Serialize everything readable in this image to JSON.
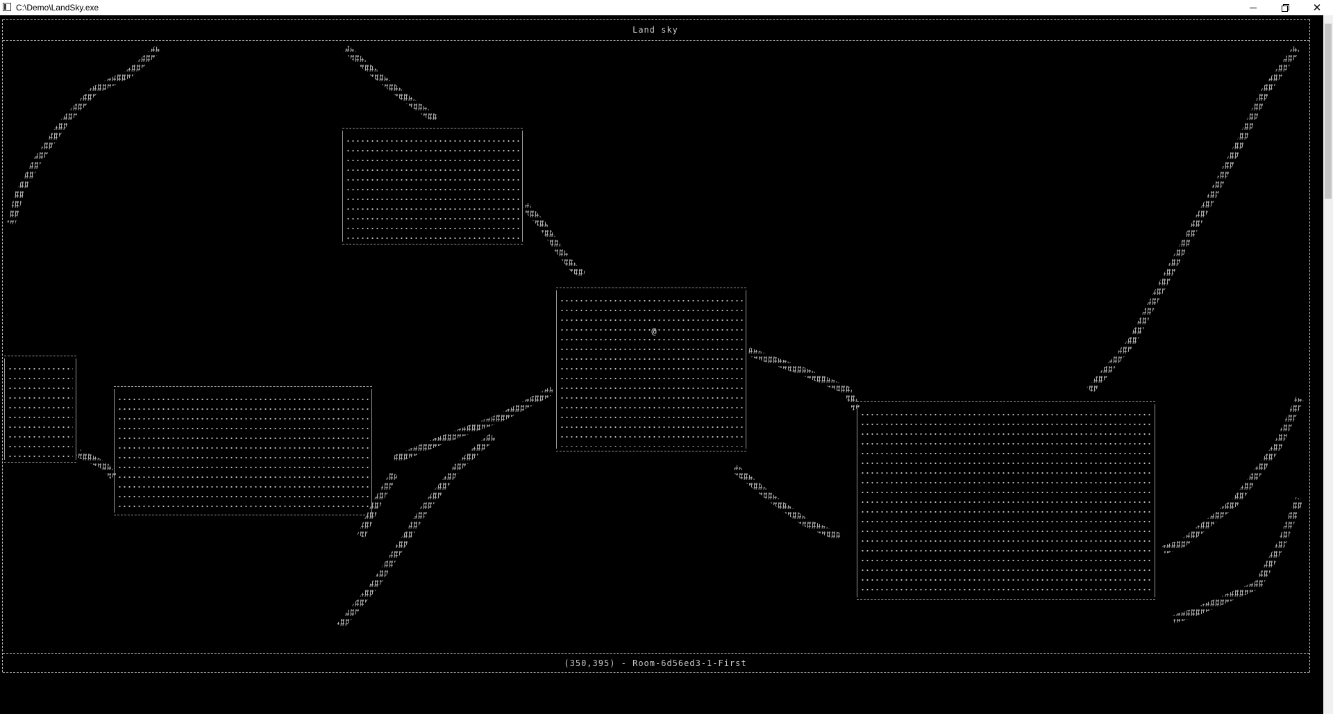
{
  "window": {
    "title": "C:\\Demo\\LandSky.exe",
    "minimize_icon": "minimize-icon",
    "maximize_icon": "restore-icon",
    "close_icon": "close-icon",
    "close_glyph": "✕"
  },
  "game": {
    "header_title": "Land sky",
    "status": "(350,395) - Room-6d56ed3-1-First",
    "player_glyph": "@",
    "floor_glyph": ".",
    "tunnel_glyph": "#",
    "colors": {
      "background": "#000000",
      "text": "#c8c8c8"
    }
  }
}
